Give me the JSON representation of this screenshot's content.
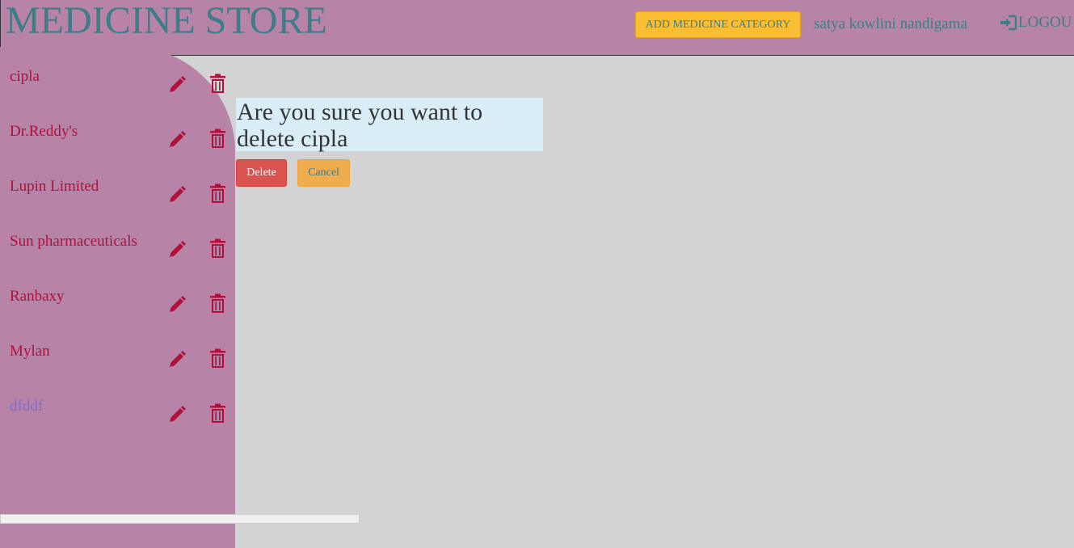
{
  "header": {
    "brand": "MEDICINE STORE",
    "add_button_label": "ADD MEDICINE CATEGORY",
    "user_name": "satya kowlini nandigama",
    "logout_label": "LOGOU"
  },
  "sidebar": {
    "items": [
      {
        "label": "cipla"
      },
      {
        "label": "Dr.Reddy's"
      },
      {
        "label": "Lupin Limited"
      },
      {
        "label": "Sun pharmaceuticals"
      },
      {
        "label": "Ranbaxy"
      },
      {
        "label": "Mylan"
      },
      {
        "label": "dfddf"
      }
    ]
  },
  "dialog": {
    "message": "Are you sure you want to delete cipla",
    "delete_label": "Delete",
    "cancel_label": "Cancel"
  },
  "colors": {
    "header_bg": "#b784a7",
    "page_bg": "#d3d3d3",
    "brand_text": "#3e7c87",
    "category_text": "#b0113a",
    "visited_link": "#7a6bd8",
    "dialog_bg": "#d9edf7",
    "delete_bg": "#d9534f",
    "cancel_bg": "#f0ad4e",
    "add_bg": "#fbbd32"
  },
  "icons": [
    "pencil-icon",
    "trash-icon",
    "log-in-icon"
  ]
}
